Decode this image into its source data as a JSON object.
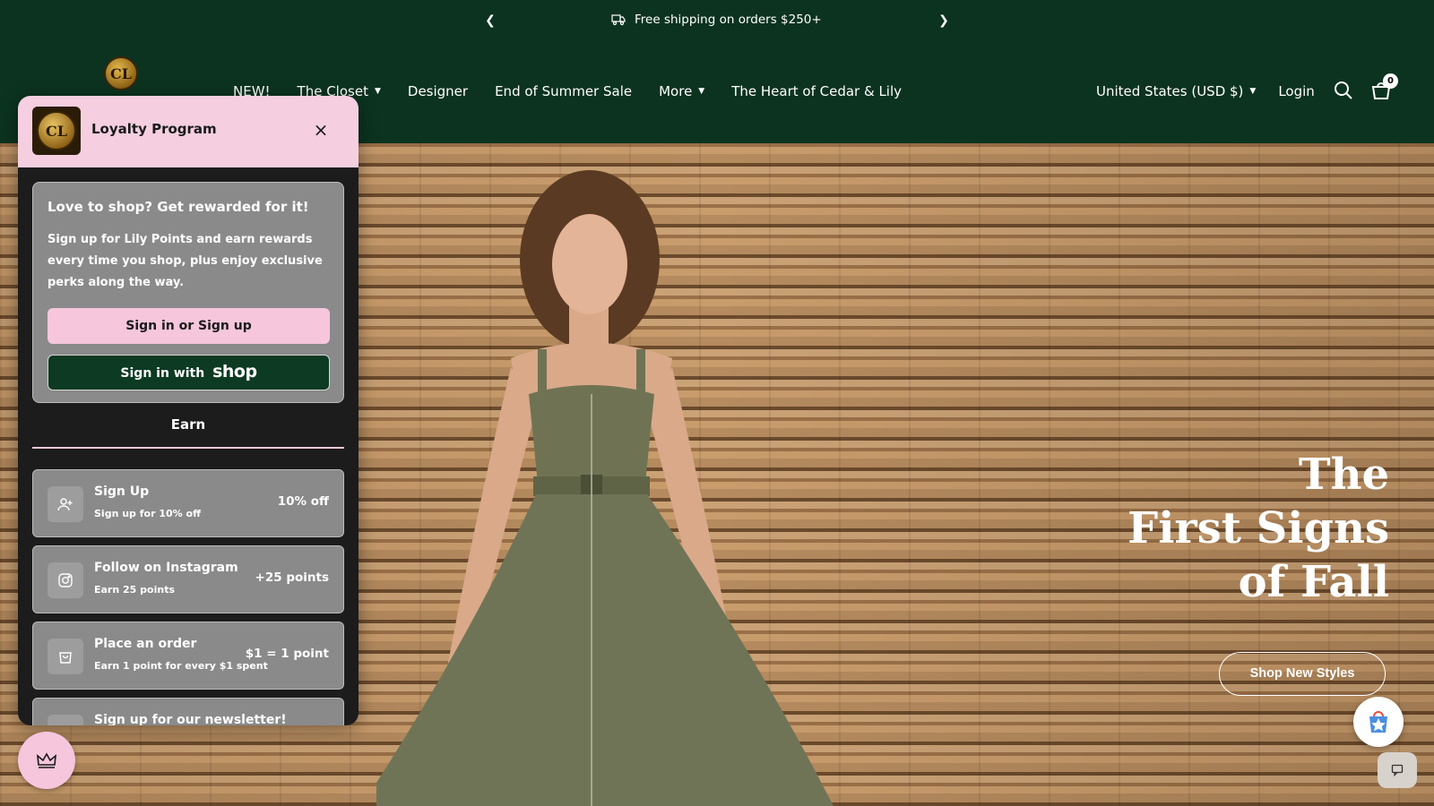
{
  "announcement": {
    "prev_icon": "chevron-left-icon",
    "next_icon": "chevron-right-icon",
    "truck_icon": "truck-icon",
    "text": "Free shipping on orders $250+"
  },
  "header": {
    "logo_text": "CL",
    "nav": [
      {
        "label": "NEW!"
      },
      {
        "label": "The Closet"
      },
      {
        "label": "Designer"
      },
      {
        "label": "End of Summer Sale"
      },
      {
        "label": "More"
      },
      {
        "label": "The Heart of Cedar & Lily"
      }
    ],
    "country": "United States (USD $)",
    "login": "Login",
    "cart_count": "0"
  },
  "hero": {
    "title_lines": [
      "The",
      "First Signs",
      "of Fall"
    ],
    "cta": "Shop New Styles"
  },
  "loyalty": {
    "panel_title": "Loyalty Program",
    "logo_text": "CL",
    "card_heading": "Love to shop? Get rewarded for it!",
    "card_body": "Sign up for Lily Points and earn rewards every time you shop, plus enjoy exclusive perks along the way.",
    "signin_label": "Sign in or Sign up",
    "shop_signin_prefix": "Sign in with",
    "shop_signin_brand": "shop",
    "earn_tab": "Earn",
    "earn_items": [
      {
        "title": "Sign Up",
        "sub": "Sign up for 10% off",
        "value": "10% off",
        "icon": "add-user-icon"
      },
      {
        "title": "Follow on Instagram",
        "sub": "Earn 25 points",
        "value": "+25 points",
        "icon": "instagram-icon"
      },
      {
        "title": "Place an order",
        "sub": "Earn 1 point for every $1 spent",
        "value": "$1 = 1 point",
        "icon": "shopping-bag-icon"
      },
      {
        "title": "Sign up for our newsletter!",
        "sub": "",
        "value": "",
        "icon": "mail-icon"
      }
    ]
  },
  "colors": {
    "header_bg": "#0c3320",
    "loyalty_pink": "#f5cfe0",
    "card_gray": "#8a8a8a"
  }
}
